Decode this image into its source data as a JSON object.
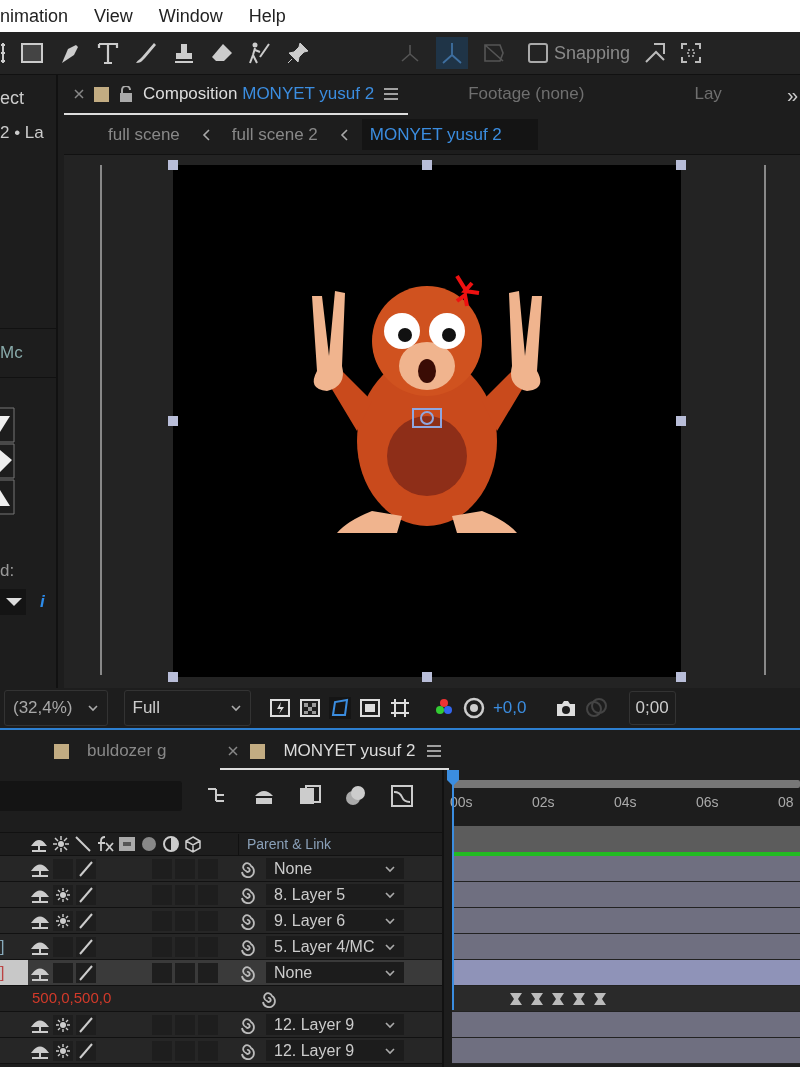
{
  "menu": [
    "nimation",
    "View",
    "Window",
    "Help"
  ],
  "toolbar": {
    "snapping": {
      "label": "Snapping",
      "checked": false
    }
  },
  "left_panel": {
    "title": "ect",
    "subtitle": "2 • La",
    "tab": "Mc",
    "field_label": "d:",
    "info": "i"
  },
  "composition_panel": {
    "tabs": [
      {
        "kind": "composition",
        "label": "Composition",
        "name": "MONYET yusuf 2",
        "selected": true
      },
      {
        "kind": "plain",
        "label": "Footage (none)",
        "selected": false
      },
      {
        "kind": "plain",
        "label": "Lay",
        "selected": false
      }
    ],
    "overflow": "»",
    "breadcrumbs": [
      {
        "label": "full scene",
        "selected": false
      },
      {
        "label": "full scene 2",
        "selected": false
      },
      {
        "label": "MONYET yusuf 2",
        "selected": true
      }
    ],
    "footer": {
      "zoom": "(32,4%)",
      "resolution": "Full",
      "exposure": "+0,0",
      "timecode": "0;00"
    }
  },
  "timeline": {
    "tabs": [
      {
        "label": "buldozer g",
        "selected": false
      },
      {
        "label": "MONYET yusuf 2",
        "selected": true
      }
    ],
    "parent_header": "Parent & Link",
    "ruler": [
      "00s",
      "02s",
      "04s",
      "06s",
      "08"
    ],
    "rows": [
      {
        "kind": "layer",
        "name": "",
        "collapse": false,
        "parent": "None",
        "selected": false
      },
      {
        "kind": "layer",
        "name": "",
        "collapse": true,
        "parent": "8. Layer 5",
        "selected": false
      },
      {
        "kind": "layer",
        "name": "",
        "collapse": true,
        "parent": "9. Layer 6",
        "selected": false
      },
      {
        "kind": "layer",
        "name": "]",
        "collapse": false,
        "parent": "5. Layer 4/MC",
        "selected": false
      },
      {
        "kind": "layer",
        "name": "]",
        "collapse": false,
        "parent": "None",
        "selected": true
      },
      {
        "kind": "property",
        "value": "500,0,500,0"
      },
      {
        "kind": "layer",
        "name": "",
        "collapse": true,
        "parent": "12. Layer 9",
        "selected": false
      },
      {
        "kind": "layer",
        "name": "",
        "collapse": true,
        "parent": "12. Layer 9",
        "selected": false
      }
    ]
  }
}
